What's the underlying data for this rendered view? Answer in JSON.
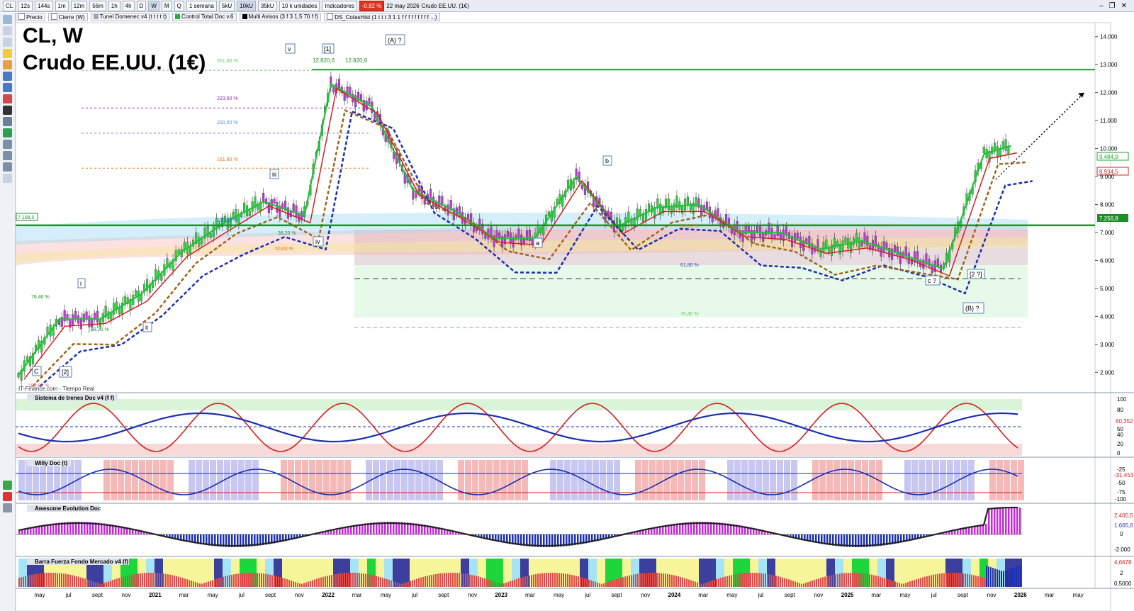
{
  "toolbar": {
    "symbol": "CL",
    "timeframes": [
      "12s",
      "144s",
      "1m",
      "12m",
      "56m",
      "1h",
      "4h",
      "D",
      "W",
      "M",
      "Q"
    ],
    "active_timeframe": "W",
    "period_select": "1 semana",
    "unit_buttons": [
      "5kU",
      "10kU",
      "35kU"
    ],
    "active_unit": "10kU",
    "units_select": "10 k unidades",
    "indicators_label": "Indicadores",
    "change_pct": "-0,82 %",
    "date": "22 may 2026",
    "instrument": "Crudo EE.UU. (1€)"
  },
  "indicator_tags": [
    {
      "label": "Precio",
      "color": "#ffffff"
    },
    {
      "label": "Cierre (W)",
      "color": "#ffffff"
    },
    {
      "label": "Tunel Domenec v4 (t t t t t)",
      "color": "#9aa6b8"
    },
    {
      "label": "Control Total Doc v.6",
      "color": "#23b33a"
    },
    {
      "label": "Multi Avisos (3 f 3 1,5 70 f f)",
      "color": "#000000"
    },
    {
      "label": "DS_CotasHist (1 t t t 3 1 1 f f f f f f f f f ...)",
      "color": "#ffffff"
    }
  ],
  "main": {
    "title_line1": "CL, W",
    "title_line2": "Crudo EE.UU. (1€)",
    "credit": "IT-Finance.com - Tiempo Real",
    "price_labels": [
      "14.000",
      "13.000",
      "12.000",
      "11.000",
      "10.000",
      "9.000",
      "8.000",
      "7.000",
      "6.000",
      "5.000",
      "4.000",
      "3.000",
      "2.000"
    ],
    "current_price": "9.484,9",
    "red_level": "8.934,5",
    "green_level": "7.256,8",
    "left_level": "7.108,0",
    "high_label": "12.820,6",
    "fib_labels": [
      "261,80 %",
      "223,60 %",
      "200,00 %",
      "161,80 %",
      "100,00 %",
      "38,20 %",
      "50,00 %",
      "76,40 %",
      "38,20 %",
      "50,00 %",
      "61,80 %",
      "76,40 %",
      "100,00 %"
    ],
    "wave_labels": [
      "v",
      "[1]",
      "(A) ?",
      "iii",
      "iv",
      "i",
      "ii",
      "C",
      "[2]",
      "b",
      "a",
      "c ?",
      "[2 ?]",
      "(B) ?"
    ],
    "months": [
      "may",
      "jul",
      "sept",
      "nov",
      "2021",
      "mar",
      "may",
      "jul",
      "sept",
      "nov",
      "2022",
      "mar",
      "may",
      "jul",
      "sept",
      "nov",
      "2023",
      "mar",
      "may",
      "jul",
      "sept",
      "nov",
      "2024",
      "mar",
      "may",
      "jul",
      "sept",
      "nov",
      "2025",
      "mar",
      "may",
      "jul",
      "sept",
      "nov",
      "2026",
      "mar",
      "may",
      "jul",
      "sept"
    ]
  },
  "panels": [
    {
      "title": "Sistema de trenes Doc v4 (f f)",
      "scale": [
        "100",
        "80",
        "60,352",
        "50",
        "40",
        "20",
        "0"
      ]
    },
    {
      "title": "Willy Doc (t)",
      "scale": [
        "-25",
        "-31,453",
        "-50",
        "-75",
        "-100"
      ]
    },
    {
      "title": "Awesome Evolution Doc",
      "scale": [
        "2.400,5",
        "1.665,6",
        "0",
        "-2.000"
      ]
    },
    {
      "title": "Barra Fuerza Fondo Mercado v4 (f)",
      "scale": [
        "4,6678",
        "2",
        "0,5000"
      ]
    }
  ],
  "chart_data": {
    "type": "line",
    "title": "CL, W",
    "subtitle": "Crudo EE.UU. (1€)",
    "xlabel": "",
    "ylabel": "",
    "ylim": [
      1500,
      14500
    ],
    "x": [
      "2020-04",
      "2020-07",
      "2020-10",
      "2021-01",
      "2021-04",
      "2021-07",
      "2021-10",
      "2022-01",
      "2022-03",
      "2022-06",
      "2022-09",
      "2022-12",
      "2023-03",
      "2023-06",
      "2023-09",
      "2023-12",
      "2024-03",
      "2024-06",
      "2024-09",
      "2024-12",
      "2025-03",
      "2025-06",
      "2025-09",
      "2025-12",
      "2026-03",
      "2026-05"
    ],
    "series": [
      {
        "values": [
          1900,
          3900,
          3900,
          4800,
          6300,
          7300,
          8100,
          7600,
          12300,
          11500,
          8500,
          7800,
          6800,
          6800,
          9000,
          7200,
          7900,
          8000,
          7000,
          7000,
          6400,
          6700,
          6200,
          5700,
          9800,
          10100
        ]
      }
    ],
    "horizontal_levels": [
      12820.6,
      9484.9,
      8934.5,
      7256.8,
      7108.0
    ],
    "grid": false
  }
}
